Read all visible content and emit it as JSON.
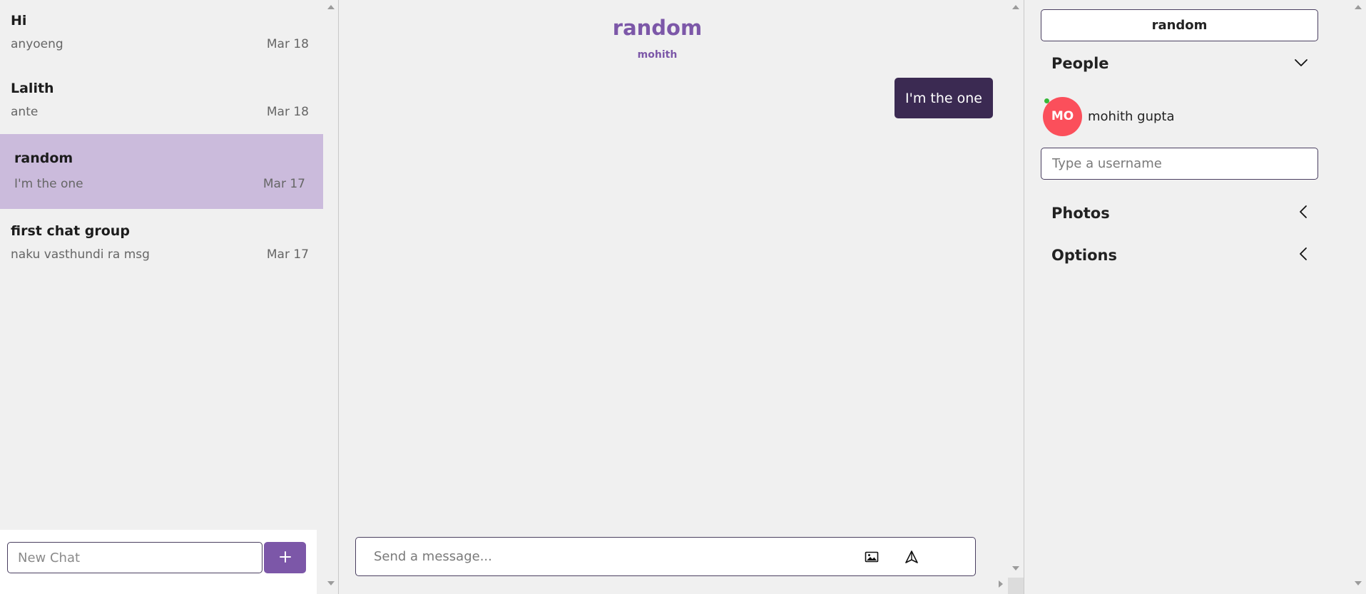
{
  "chat_list": {
    "items": [
      {
        "title": "Hi",
        "preview": "anyoeng",
        "date": "Mar 18",
        "active": false
      },
      {
        "title": "Lalith",
        "preview": "ante",
        "date": "Mar 18",
        "active": false
      },
      {
        "title": "random",
        "preview": "I'm the one",
        "date": "Mar 17",
        "active": true
      },
      {
        "title": "first chat group",
        "preview": "naku vasthundi ra msg",
        "date": "Mar 17",
        "active": false
      }
    ],
    "new_chat_placeholder": "New Chat",
    "new_chat_button_icon": "plus-icon"
  },
  "feed": {
    "title": "random",
    "subtitle": "mohith",
    "messages": [
      {
        "text": "I'm the one",
        "own": true
      }
    ],
    "composer_placeholder": "Send a message...",
    "attach_icon": "image-icon",
    "send_icon": "send-icon"
  },
  "settings": {
    "title": "random",
    "people_label": "People",
    "people_icon": "chevron-down-icon",
    "people": [
      {
        "initials": "MO",
        "name": "mohith gupta",
        "online": true,
        "avatar_color": "#fb4f5b"
      }
    ],
    "username_placeholder": "Type a username",
    "photos_label": "Photos",
    "options_label": "Options",
    "collapsed_icon": "chevron-left-icon"
  },
  "colors": {
    "accent": "#7c57a8",
    "active_chat_bg": "#cbbbdc",
    "own_message_bg": "#3b2a52",
    "online": "#38b83a"
  }
}
